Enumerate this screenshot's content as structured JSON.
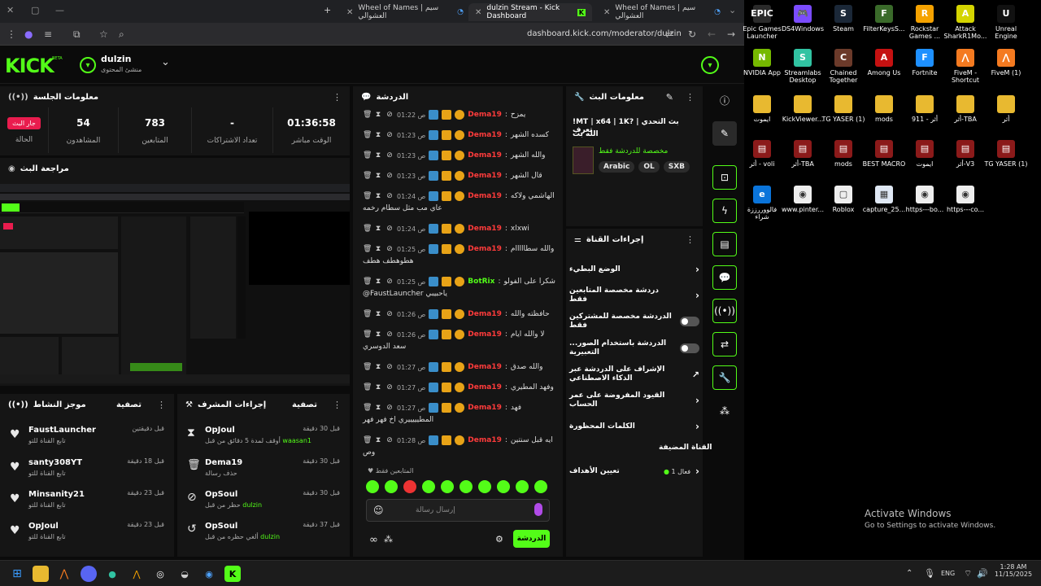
{
  "browser": {
    "tabs": [
      {
        "label": "Wheel of Names | سيم العشوالي"
      },
      {
        "label": "dulzin Stream - Kick Dashboard",
        "active": true
      },
      {
        "label": "Wheel of Names | سيم العشوالي"
      }
    ],
    "url": "dashboard.kick.com/moderator/dulzin"
  },
  "header": {
    "logo": "KICK",
    "beta": "BETA",
    "channel_name": "dulzin",
    "channel_role": "منشئ المحتوى"
  },
  "session": {
    "title": "معلومات الجلسة",
    "stats": [
      {
        "label": "الوقت مباشر",
        "value": "01:36:58"
      },
      {
        "label": "تعداد الاشتراكات",
        "value": "-"
      },
      {
        "label": "المتابعين",
        "value": "783"
      },
      {
        "label": "المشاهدون",
        "value": "54"
      },
      {
        "label": "الحالة",
        "value": "جار البث"
      }
    ]
  },
  "stream_preview": {
    "title": "مراجعة البث"
  },
  "activity": {
    "title": "موجز النشاط",
    "filter": "تصفية",
    "items": [
      {
        "name": "FaustLauncher",
        "sub": "تابع القناة للتو",
        "time": "قبل دقيقتين"
      },
      {
        "name": "santy308YT",
        "sub": "تابع القناة للتو",
        "time": "قبل 18 دقيقة"
      },
      {
        "name": "Minsanity21",
        "sub": "تابع القناة للتو",
        "time": "قبل 23 دقيقة"
      },
      {
        "name": "OpJoul",
        "sub": "تابع القناة للتو",
        "time": "قبل 23 دقيقة"
      }
    ]
  },
  "mod_actions": {
    "title": "إجراءات المشرف",
    "filter": "تصفية",
    "items": [
      {
        "name": "OpJoul",
        "sub": "أوقف لمدة 5 دقائق من قبل",
        "by": "waasan1",
        "time": "قبل 30 دقيقة"
      },
      {
        "name": "Dema19",
        "sub": "حذف رسالة",
        "by": "",
        "time": "قبل 30 دقيقة"
      },
      {
        "name": "OpSoul",
        "sub": "حظر من قبل",
        "by": "dulzin",
        "time": "قبل 30 دقيقة"
      },
      {
        "name": "OpSoul",
        "sub": "ألغي حظره من قبل",
        "by": "dulzin",
        "time": "قبل 37 دقيقة"
      }
    ]
  },
  "chat": {
    "title": "الدردشة",
    "messages": [
      {
        "time": "01:22 ص",
        "user": "Dema19",
        "color": "#ff3b3b",
        "text": "يمزح"
      },
      {
        "time": "01:23 ص",
        "user": "Dema19",
        "color": "#ff3b3b",
        "text": "كسده الشهر"
      },
      {
        "time": "01:23 ص",
        "user": "Dema19",
        "color": "#ff3b3b",
        "text": "والله الشهر"
      },
      {
        "time": "01:23 ص",
        "user": "Dema19",
        "color": "#ff3b3b",
        "text": "قال الشهر"
      },
      {
        "time": "01:24 ص",
        "user": "Dema19",
        "color": "#ff3b3b",
        "text": "الهاشمي ولاكه",
        "text2": "عاي مب مثل سطام رخمه"
      },
      {
        "time": "01:24 ص",
        "user": "Dema19",
        "color": "#ff3b3b",
        "text": "xlxwi"
      },
      {
        "time": "01:25 ص",
        "user": "Dema19",
        "color": "#ff3b3b",
        "text": "والله سطااااام",
        "text2": "هطوهطف هطف"
      },
      {
        "time": "01:25 ص",
        "user": "BotRix",
        "color": "#53fc18",
        "text": "شكرا على الفولو",
        "text2": "@FaustLauncher ياحبيبي"
      },
      {
        "time": "01:26 ص",
        "user": "Dema19",
        "color": "#ff3b3b",
        "text": "حافظته والله"
      },
      {
        "time": "01:26 ص",
        "user": "Dema19",
        "color": "#ff3b3b",
        "text": "لا والله ايام",
        "text2": "سعد الدوسري"
      },
      {
        "time": "01:27 ص",
        "user": "Dema19",
        "color": "#ff3b3b",
        "text": "والله صدق"
      },
      {
        "time": "01:27 ص",
        "user": "Dema19",
        "color": "#ff3b3b",
        "text": "وفهد المطيري"
      },
      {
        "time": "01:27 ص",
        "user": "Dema19",
        "color": "#ff3b3b",
        "text": "فهد",
        "text2": "المطيييييري اخ فهر فهر"
      },
      {
        "time": "01:28 ص",
        "user": "Dema19",
        "color": "#ff3b3b",
        "text": "ايه قبل سنتين",
        "text2": "وص"
      }
    ],
    "followers_only": "المتابعين فقط",
    "input_placeholder": "إرسال رسالة",
    "send_label": "الدردشة"
  },
  "stream_info": {
    "title": "معلومات البث",
    "stream_title": "!MT | x64 | 1K? | بث التحدي تعرف",
    "stream_title2": "الله بث",
    "category": "مخصصة للدردشة فقط",
    "tags": [
      "Arabic",
      "OL",
      "SXB"
    ]
  },
  "channel_actions": {
    "title": "إجراءات القناة",
    "items": [
      {
        "label": "الوضع البطيء",
        "control": "chevron"
      },
      {
        "label": "دردشة مخصصة المتابعين فقط",
        "control": "chevron"
      },
      {
        "label": "الدردشة مخصصة للمشتركين فقط",
        "control": "toggle"
      },
      {
        "label": "...الدردشة باستخدام الصور التعبيرية",
        "control": "toggle"
      },
      {
        "label": "الإشراف على الدردشة عبر الذكاء الاصطناعي",
        "control": "external"
      },
      {
        "label": "القيود المفروضة على عمر الحساب",
        "control": "chevron"
      },
      {
        "label": "الكلمات المحظورة",
        "control": "chevron"
      }
    ],
    "promoted_title": "القناة المضيفة",
    "goals_label": "تعيين الأهداف",
    "goals_status": "فعال 1"
  },
  "desktop": {
    "icons": [
      {
        "label": "Epic Games Launcher",
        "color": "#2a2a2a",
        "glyph": "EPIC"
      },
      {
        "label": "DS4Windows",
        "color": "#7b4cff",
        "glyph": "🎮"
      },
      {
        "label": "Steam",
        "color": "#1b2838",
        "glyph": "S"
      },
      {
        "label": "FilterKeysS...",
        "color": "#3a6a2a",
        "glyph": "F"
      },
      {
        "label": "Rockstar Games ...",
        "color": "#f5a200",
        "glyph": "R"
      },
      {
        "label": "Attack SharkR1Mo...",
        "color": "#d4d400",
        "glyph": "A"
      },
      {
        "label": "Unreal Engine",
        "color": "#111",
        "glyph": "U"
      },
      {
        "label": "NVIDIA App",
        "color": "#76b900",
        "glyph": "N"
      },
      {
        "label": "Streamlabs Desktop",
        "color": "#31c3a2",
        "glyph": "S"
      },
      {
        "label": "Chained Together",
        "color": "#6b3a2a",
        "glyph": "C"
      },
      {
        "label": "Among Us",
        "color": "#c51111",
        "glyph": "A"
      },
      {
        "label": "Fortnite",
        "color": "#1e90ff",
        "glyph": "F"
      },
      {
        "label": "FiveM - Shortcut",
        "color": "#f47a20",
        "glyph": "⋀"
      },
      {
        "label": "FiveM (1)",
        "color": "#f47a20",
        "glyph": "⋀"
      },
      {
        "label": "ايموت",
        "color": "#e8b930",
        "glyph": ""
      },
      {
        "label": "KickViewer...",
        "color": "#e8b930",
        "glyph": ""
      },
      {
        "label": "TG YASER (1)",
        "color": "#e8b930",
        "glyph": ""
      },
      {
        "label": "mods",
        "color": "#e8b930",
        "glyph": ""
      },
      {
        "label": "أثر - 911",
        "color": "#e8b930",
        "glyph": ""
      },
      {
        "label": "أثر-TBA",
        "color": "#e8b930",
        "glyph": ""
      },
      {
        "label": "أثر",
        "color": "#e8b930",
        "glyph": ""
      },
      {
        "label": "أثر - voli",
        "color": "#8b1a1a",
        "glyph": "▤"
      },
      {
        "label": "أثر-TBA",
        "color": "#8b1a1a",
        "glyph": "▤"
      },
      {
        "label": "mods",
        "color": "#8b1a1a",
        "glyph": "▤"
      },
      {
        "label": "BEST MACRO",
        "color": "#8b1a1a",
        "glyph": "▤"
      },
      {
        "label": "ايموت",
        "color": "#8b1a1a",
        "glyph": "▤"
      },
      {
        "label": "أثر-V3",
        "color": "#8b1a1a",
        "glyph": "▤"
      },
      {
        "label": "TG YASER (1)",
        "color": "#8b1a1a",
        "glyph": "▤"
      },
      {
        "label": "فالووررززة شراء",
        "color": "#0a74da",
        "glyph": "e"
      },
      {
        "label": "www.pinter...",
        "color": "#eee",
        "glyph": "◉"
      },
      {
        "label": "Roblox",
        "color": "#eee",
        "glyph": "▢"
      },
      {
        "label": "capture_25...",
        "color": "#dfe8f4",
        "glyph": "▦"
      },
      {
        "label": "https---bo...",
        "color": "#eee",
        "glyph": "◉"
      },
      {
        "label": "https---co...",
        "color": "#eee",
        "glyph": "◉"
      }
    ],
    "activate_title": "Activate Windows",
    "activate_sub": "Go to Settings to activate Windows."
  },
  "taskbar": {
    "lang": "ENG",
    "time": "1:28 AM",
    "date": "11/15/2025"
  }
}
